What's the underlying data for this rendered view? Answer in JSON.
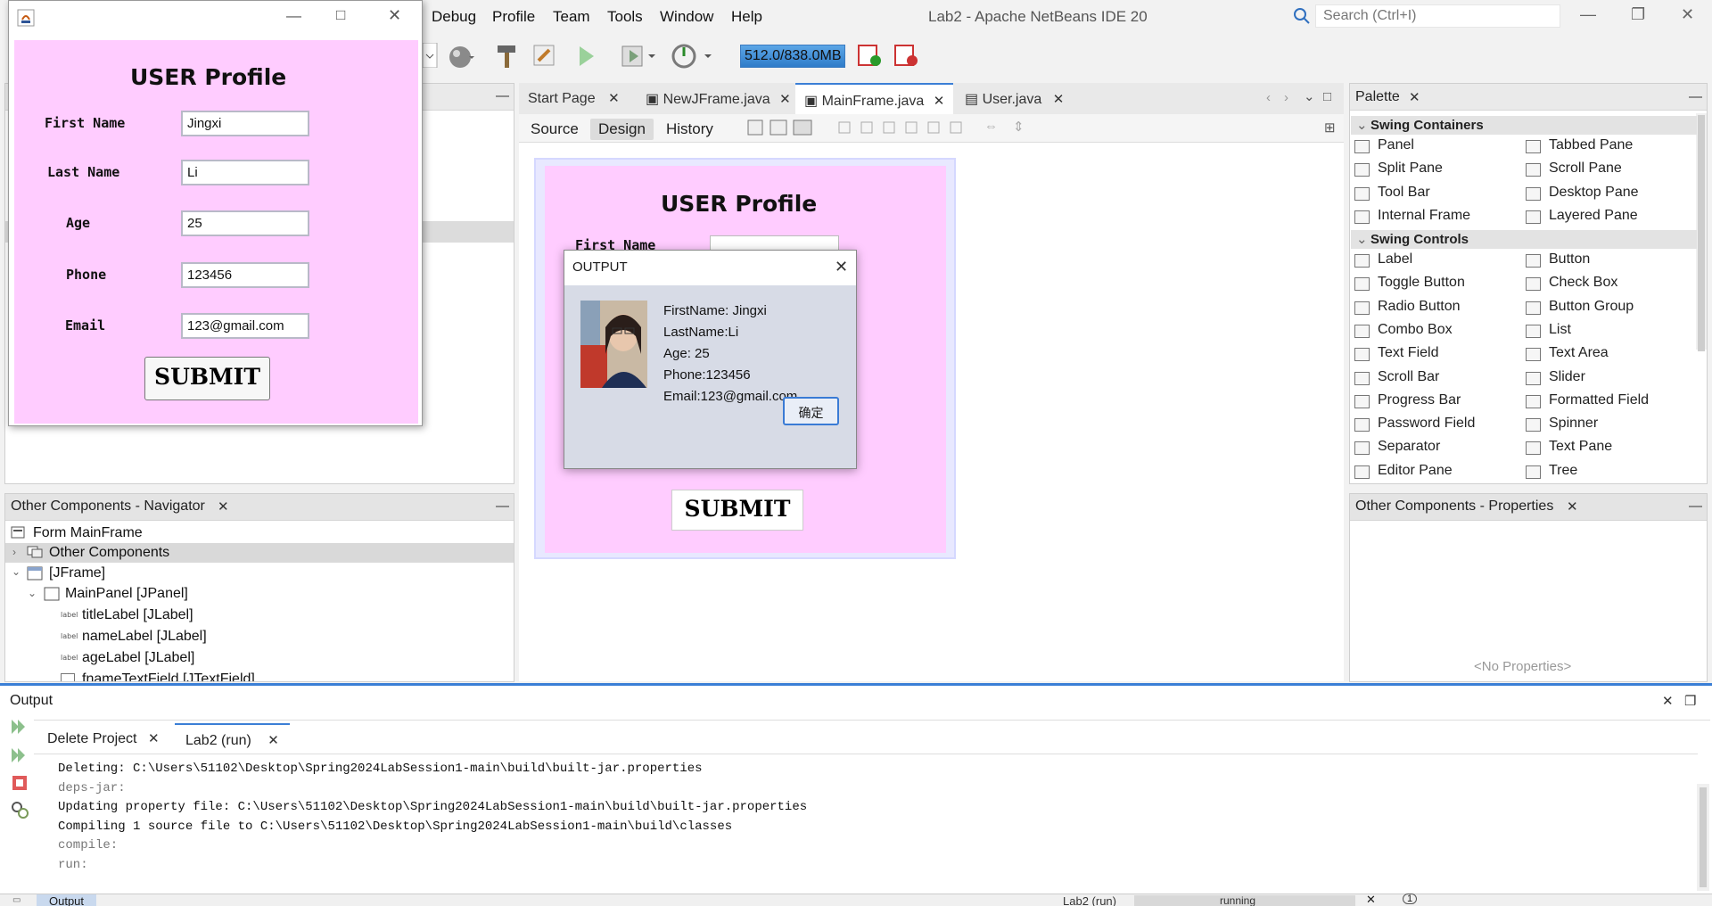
{
  "window": {
    "title": "Lab2 - Apache NetBeans IDE 20",
    "search_placeholder": "Search (Ctrl+I)"
  },
  "menu": [
    "Debug",
    "Profile",
    "Team",
    "Tools",
    "Window",
    "Help"
  ],
  "toolbar": {
    "memory": "512.0/838.0MB"
  },
  "editor": {
    "tabs": [
      "Start Page",
      "NewJFrame.java",
      "MainFrame.java",
      "User.java"
    ],
    "active_tab": "MainFrame.java",
    "view_tabs": [
      "Source",
      "Design",
      "History"
    ],
    "active_view": "Design"
  },
  "app_window": {
    "heading": "USER Profile",
    "fields": [
      {
        "label": "First Name",
        "value": "Jingxi"
      },
      {
        "label": "Last Name",
        "value": "Li"
      },
      {
        "label": "Age",
        "value": "25"
      },
      {
        "label": "Phone",
        "value": "123456"
      },
      {
        "label": "Email",
        "value": "123@gmail.com"
      }
    ],
    "submit_label": "SUBMIT"
  },
  "preview": {
    "heading": "USER Profile",
    "first_label": "First Name",
    "submit_label": "SUBMIT"
  },
  "dialog": {
    "title": "OUTPUT",
    "lines": [
      "FirstName: Jingxi",
      "LastName:Li",
      "Age: 25",
      "Phone:123456",
      "Email:123@gmail.com"
    ],
    "ok_label": "确定"
  },
  "navigator": {
    "title": "Other Components - Navigator",
    "items": [
      "Form MainFrame",
      "Other Components",
      "[JFrame]",
      "MainPanel [JPanel]",
      "titleLabel [JLabel]",
      "nameLabel [JLabel]",
      "ageLabel [JLabel]",
      "fnameTextField [JTextField]"
    ]
  },
  "palette": {
    "title": "Palette",
    "sections": [
      {
        "name": "Swing Containers",
        "items": [
          "Panel",
          "Tabbed Pane",
          "Split Pane",
          "Scroll Pane",
          "Tool Bar",
          "Desktop Pane",
          "Internal Frame",
          "Layered Pane"
        ]
      },
      {
        "name": "Swing Controls",
        "items": [
          "Label",
          "Button",
          "Toggle Button",
          "Check Box",
          "Radio Button",
          "Button Group",
          "Combo Box",
          "List",
          "Text Field",
          "Text Area",
          "Scroll Bar",
          "Slider",
          "Progress Bar",
          "Formatted Field",
          "Password Field",
          "Spinner",
          "Separator",
          "Text Pane",
          "Editor Pane",
          "Tree"
        ]
      }
    ]
  },
  "properties": {
    "title": "Other Components - Properties",
    "empty": "<No Properties>"
  },
  "output": {
    "title": "Output",
    "tabs": [
      "Delete Project",
      "Lab2 (run)"
    ],
    "active_tab": "Lab2 (run)",
    "lines": [
      {
        "text": "Deleting: C:\\Users\\51102\\Desktop\\Spring2024LabSession1-main\\build\\built-jar.properties",
        "muted": false
      },
      {
        "text": "deps-jar:",
        "muted": true
      },
      {
        "text": "Updating property file: C:\\Users\\51102\\Desktop\\Spring2024LabSession1-main\\build\\built-jar.properties",
        "muted": false
      },
      {
        "text": "Compiling 1 source file to C:\\Users\\51102\\Desktop\\Spring2024LabSession1-main\\build\\classes",
        "muted": false
      },
      {
        "text": "compile:",
        "muted": true
      },
      {
        "text": "run:",
        "muted": true
      }
    ]
  },
  "status": {
    "output_tab": "Output",
    "task": "Lab2 (run)",
    "state": "running",
    "notifications": "1"
  }
}
